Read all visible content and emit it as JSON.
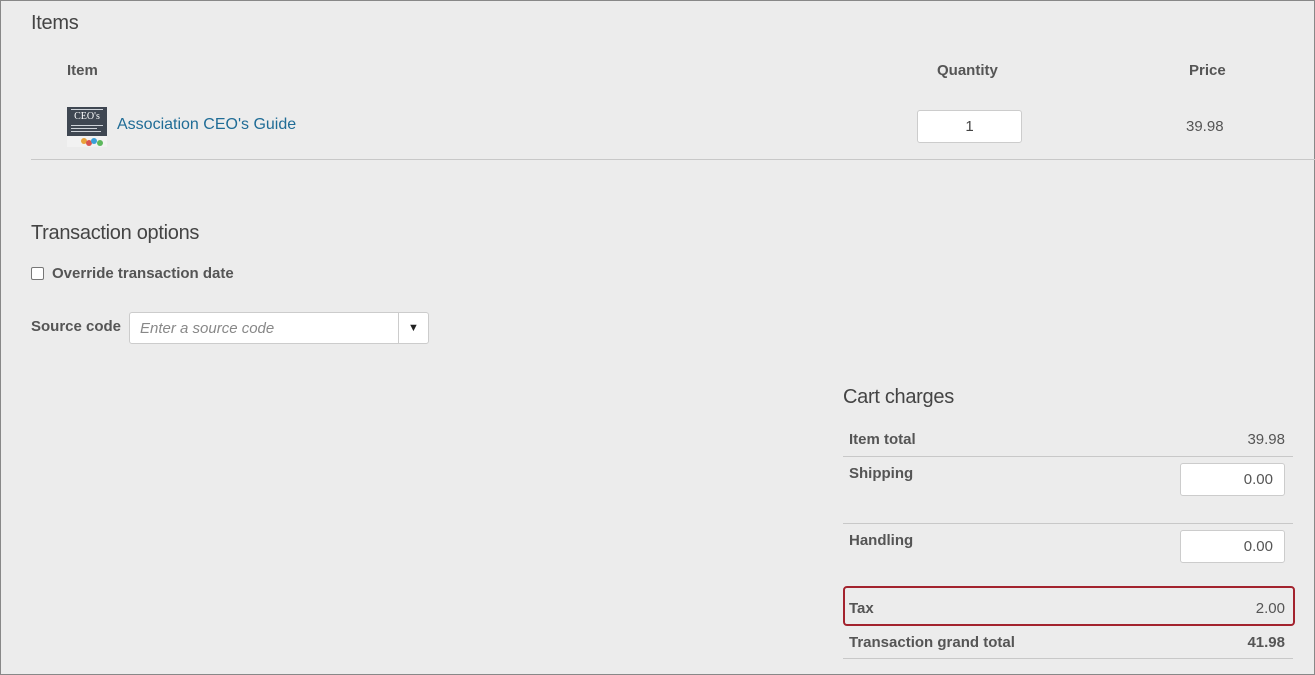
{
  "items_section": {
    "title": "Items",
    "headers": {
      "item": "Item",
      "quantity": "Quantity",
      "price": "Price"
    },
    "rows": [
      {
        "thumbnail_text": "CEO's",
        "name": "Association CEO's Guide",
        "quantity": "1",
        "price": "39.98"
      }
    ]
  },
  "transaction_options": {
    "title": "Transaction options",
    "override_date_label": "Override transaction date",
    "override_date_checked": false,
    "source_code_label": "Source code",
    "source_code_placeholder": "Enter a source code",
    "source_code_value": ""
  },
  "cart_charges": {
    "title": "Cart charges",
    "item_total_label": "Item total",
    "item_total_value": "39.98",
    "shipping_label": "Shipping",
    "shipping_value": "0.00",
    "handling_label": "Handling",
    "handling_value": "0.00",
    "tax_label": "Tax",
    "tax_value": "2.00",
    "grand_total_label": "Transaction grand total",
    "grand_total_value": "41.98",
    "highlight_color": "#a3232e"
  },
  "colors": {
    "link": "#1f6c96",
    "background": "#ececec"
  },
  "icons": {
    "dropdown": "caret-down-icon"
  }
}
